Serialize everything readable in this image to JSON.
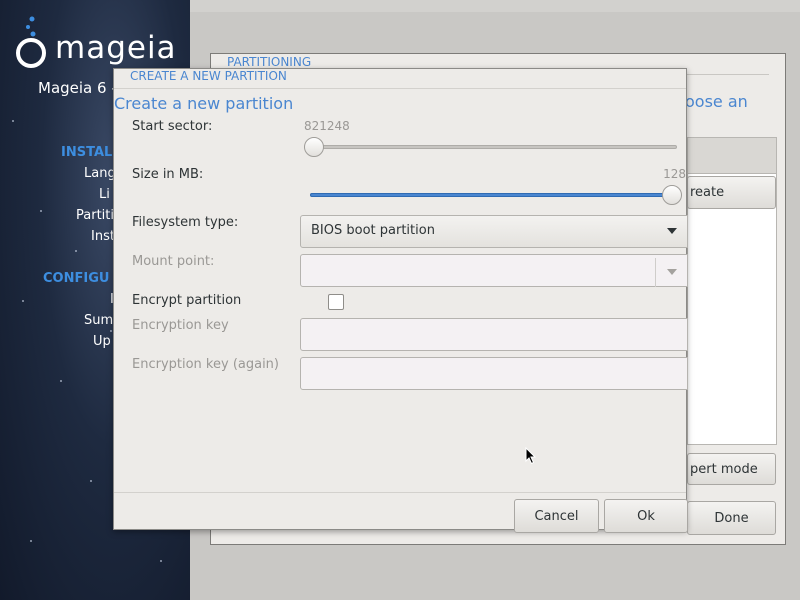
{
  "sidebar": {
    "brand": "mageia",
    "version": "Mageia 6 -",
    "sections": [
      {
        "heading": "INSTAL",
        "items": [
          "Lang",
          "Li",
          "Partiti",
          "Inst"
        ]
      },
      {
        "heading": "CONFIGU",
        "items": [
          "I",
          "Sum",
          "Up"
        ]
      }
    ]
  },
  "partitioning_window": {
    "title": "PARTITIONING",
    "heading_fragment": "oose an",
    "create_button": "reate",
    "expert_button": "pert mode",
    "done_button": "Done"
  },
  "dialog": {
    "window_title": "CREATE A NEW PARTITION",
    "heading": "Create a new partition",
    "start_sector": {
      "label": "Start sector:",
      "value": "821248",
      "fraction": 0.0
    },
    "size_mb": {
      "label": "Size in MB:",
      "value": "128",
      "fraction": 1.0
    },
    "filesystem": {
      "label": "Filesystem type:",
      "selected": "BIOS boot partition"
    },
    "mount_point": {
      "label": "Mount point:",
      "value": ""
    },
    "encrypt": {
      "label": "Encrypt partition",
      "checked": false
    },
    "encryption_key": {
      "label": "Encryption key",
      "value": ""
    },
    "encryption_key_again": {
      "label": "Encryption key (again)",
      "value": ""
    },
    "cancel_button": "Cancel",
    "ok_button": "Ok"
  },
  "colors": {
    "accent": "#4a86d0",
    "sidebar_heading": "#3d8ee0",
    "sidebar_bg": "#1e2a40",
    "dialog_bg": "#edebe8"
  }
}
